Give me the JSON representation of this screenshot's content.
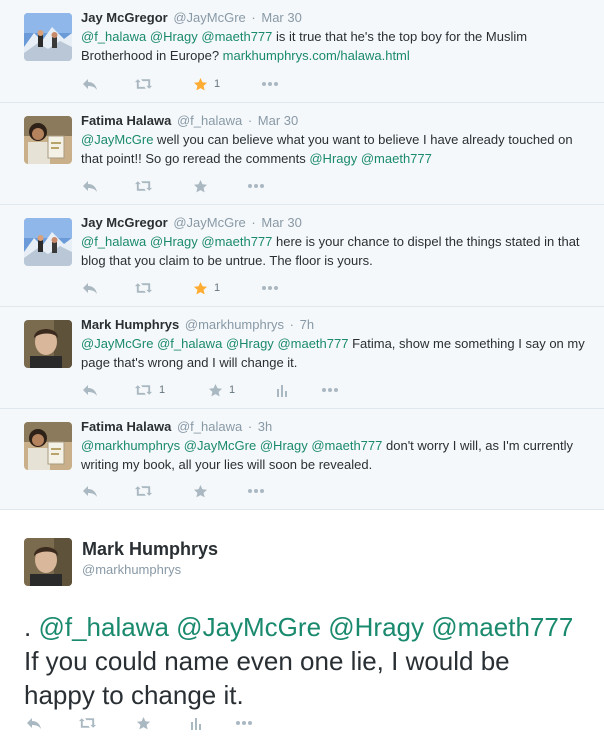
{
  "thread": [
    {
      "fullname": "Jay McGregor",
      "username": "@JayMcGre",
      "time": "Mar 30",
      "avatar": "snowy-mountain-avatar",
      "mentions_a": [
        "@f_halawa",
        "@Hragy",
        "@maeth777"
      ],
      "text_a": " is it true that he's the top boy for the Muslim Brotherhood in Europe? ",
      "link": "markhumphrys.com/halawa.html",
      "actions": {
        "favorite_count": "1",
        "favorited": true
      }
    },
    {
      "fullname": "Fatima Halawa",
      "username": "@f_halawa",
      "time": "Mar 30",
      "avatar": "person-holding-book-avatar",
      "mention_lead": "@JayMcGre",
      "text_a": " well you can believe what you want to believe I have already touched on that point!! So go reread the comments ",
      "mentions_b": [
        "@Hragy",
        "@maeth777"
      ]
    },
    {
      "fullname": "Jay McGregor",
      "username": "@JayMcGre",
      "time": "Mar 30",
      "avatar": "snowy-mountain-avatar",
      "mentions_a": [
        "@f_halawa",
        "@Hragy",
        "@maeth777"
      ],
      "text_a": " here is your chance to dispel the things stated in that blog that you claim to be untrue. The floor is yours.",
      "actions": {
        "favorite_count": "1",
        "favorited": true
      }
    },
    {
      "fullname": "Mark Humphrys",
      "username": "@markhumphrys",
      "time": "7h",
      "avatar": "man-portrait-avatar",
      "mentions_a": [
        "@JayMcGre",
        "@f_halawa",
        "@Hragy",
        "@maeth777"
      ],
      "text_a": "  Fatima, show me something I say on my page that's wrong and I will change it.",
      "actions": {
        "retweet_count": "1",
        "favorite_count": "1"
      }
    },
    {
      "fullname": "Fatima Halawa",
      "username": "@f_halawa",
      "time": "3h",
      "avatar": "person-holding-book-avatar",
      "mentions_a": [
        "@markhumphrys",
        "@JayMcGre",
        "@Hragy",
        "@maeth777"
      ],
      "text_a": " don't worry I will, as I'm currently writing my book, all your lies will soon be revealed."
    }
  ],
  "main_tweet": {
    "fullname": "Mark Humphrys",
    "username": "@markhumphrys",
    "avatar": "man-portrait-avatar",
    "lead": ". ",
    "mentions": [
      "@f_halawa",
      "@JayMcGre",
      "@Hragy",
      "@maeth777"
    ],
    "text": "  If you could name even one lie, I would be happy to change it."
  },
  "colors": {
    "mention": "#1a8a6e",
    "favorite_active": "#ffac33",
    "icon_gray": "#aab8c2",
    "thread_bg": "#f5f8fa"
  }
}
